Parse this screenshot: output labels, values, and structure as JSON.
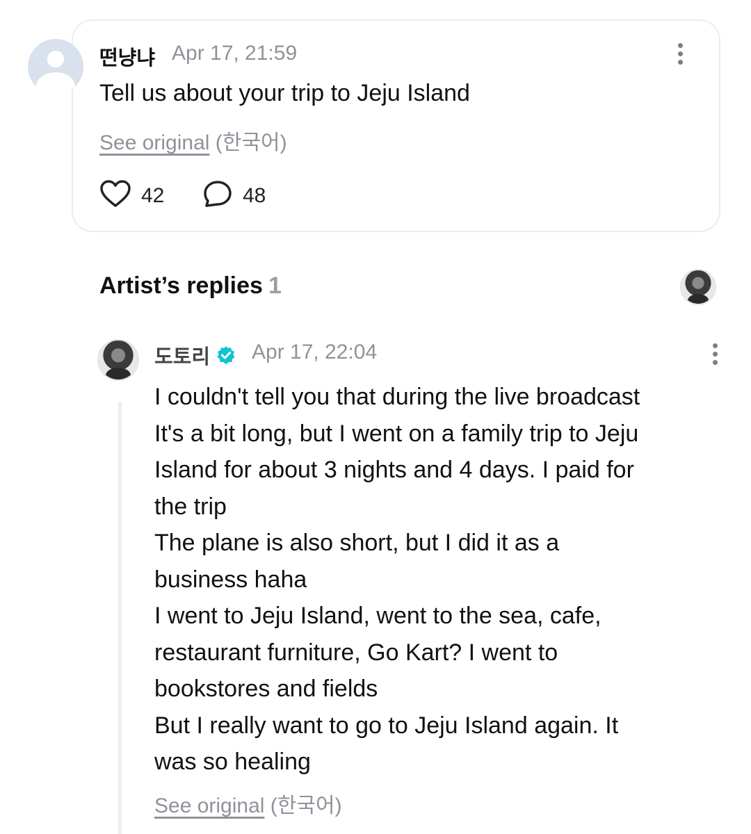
{
  "comment": {
    "author": "떤냥냐",
    "timestamp": "Apr 17, 21:59",
    "text": "Tell us about your trip to Jeju Island",
    "see_original": "See original",
    "language": "(한국어)",
    "likes": "42",
    "replies": "48"
  },
  "artist_replies": {
    "title": "Artist’s replies",
    "count": "1"
  },
  "reply": {
    "author": "도토리",
    "timestamp": "Apr 17, 22:04",
    "lines": [
      "I couldn't tell you that during the live broadcast",
      "It's a bit long, but I went on a family trip to Jeju",
      "Island for about 3 nights and 4 days. I paid for",
      "the trip",
      "The plane is also short, but I did it as a",
      "business haha",
      "I went to Jeju Island, went to the sea, cafe,",
      "restaurant furniture, Go Kart? I went to",
      "bookstores and fields",
      "But I really want to go to Jeju Island again. It",
      "was so healing"
    ],
    "see_original": "See original",
    "language": "(한국어)"
  },
  "colors": {
    "verified_badge": "#13c1d3",
    "muted_text": "#8e9299",
    "card_border": "#ececec"
  },
  "icons": [
    "heart-icon",
    "comment-bubble-icon",
    "more-options-icon",
    "verified-badge-icon"
  ]
}
